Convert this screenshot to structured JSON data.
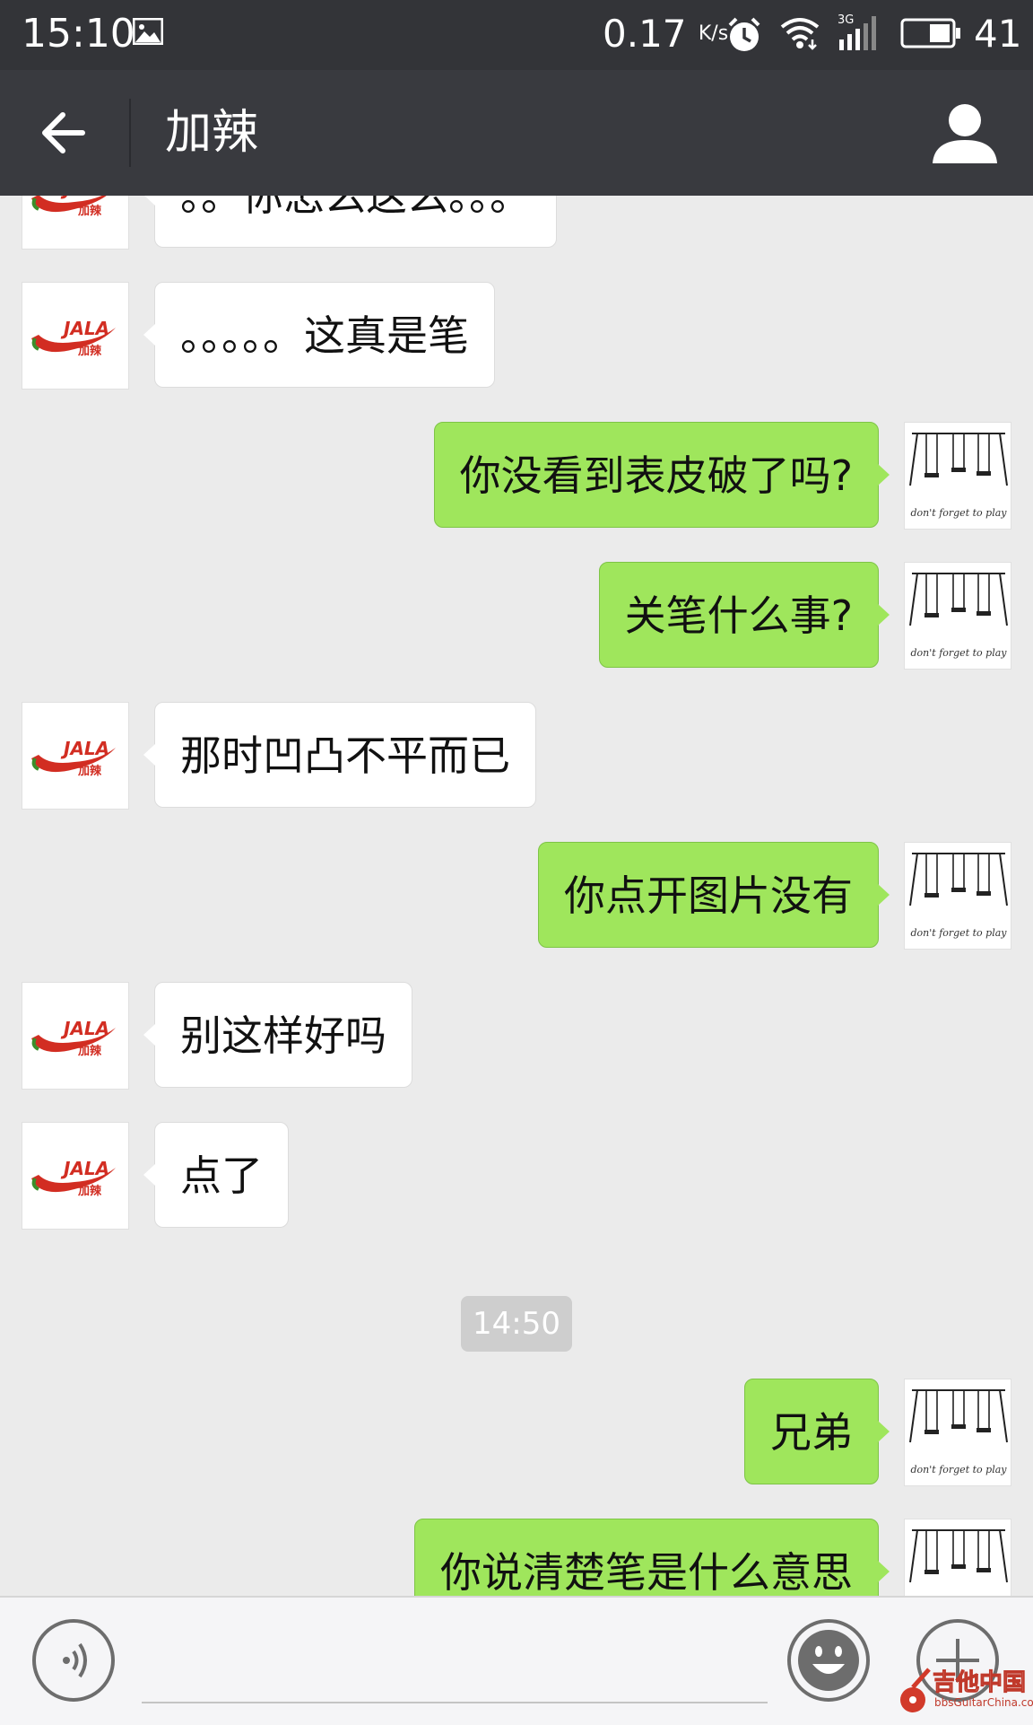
{
  "status_bar": {
    "time": "15:10",
    "net_speed": "0.17",
    "net_unit": "K/s",
    "network_type": "3G",
    "battery": "41",
    "icons": [
      "image-icon",
      "alarm-icon",
      "wifi-icon",
      "signal-icon",
      "battery-icon"
    ]
  },
  "header": {
    "title": "加辣",
    "back_icon": "arrow-left-icon",
    "profile_icon": "person-icon"
  },
  "contact_avatar": {
    "logo_text": "JALA",
    "logo_subtext": "加辣"
  },
  "my_avatar": {
    "caption": "don't forget to play"
  },
  "messages": [
    {
      "side": "left",
      "text": "。。你怎么这么。。。"
    },
    {
      "side": "left",
      "text": "。。。。。这真是笔"
    },
    {
      "side": "right",
      "text": "你没看到表皮破了吗?"
    },
    {
      "side": "right",
      "text": "关笔什么事?"
    },
    {
      "side": "left",
      "text": "那时凹凸不平而已"
    },
    {
      "side": "right",
      "text": "你点开图片没有"
    },
    {
      "side": "left",
      "text": "别这样好吗"
    },
    {
      "side": "left",
      "text": "点了"
    },
    {
      "side": "right",
      "text": "兄弟"
    },
    {
      "side": "right",
      "text": "你说清楚笔是什么意思"
    }
  ],
  "timestamp": "14:50",
  "input_bar": {
    "placeholder": "",
    "icons": [
      "voice-icon",
      "emoji-icon",
      "plus-icon"
    ]
  },
  "watermark": {
    "text": "吉他中国",
    "url": "bbsGuitarChina.com"
  },
  "colors": {
    "status_bar": "#333438",
    "title_bar": "#393a3f",
    "chat_bg": "#ebebeb",
    "my_bubble": "#9fe65c",
    "their_bubble": "#ffffff"
  }
}
